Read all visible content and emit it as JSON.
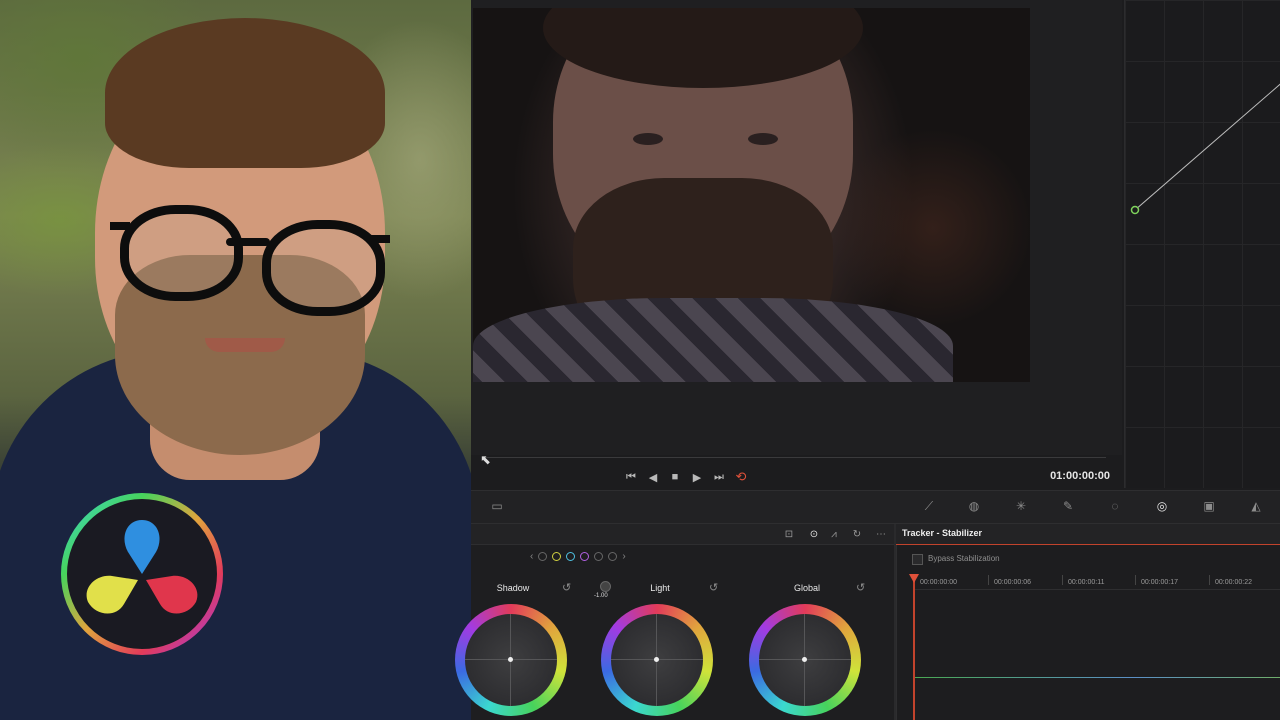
{
  "viewer": {
    "timecode": "01:00:00:00"
  },
  "transport": {
    "skip_back_glyph": "⏮",
    "prev_frame_glyph": "◀",
    "stop_glyph": "■",
    "play_glyph": "▶",
    "skip_forward_glyph": "⏭",
    "loop_glyph": "⟲"
  },
  "color_wheels": {
    "shadow_label": "Shadow",
    "light_label": "Light",
    "global_label": "Global",
    "light_value": "-1.00",
    "reset_glyph": "↺",
    "nav_prev": "‹",
    "nav_next": "›"
  },
  "tracker": {
    "title": "Tracker - Stabilizer",
    "bypass_label": "Bypass Stabilization",
    "ruler_times": [
      "00:00:00:00",
      "00:00:00:06",
      "00:00:00:11",
      "00:00:00:17",
      "00:00:00:22"
    ]
  },
  "colors": {
    "accent_red": "#e0513a",
    "panel_bg": "#1e1e20",
    "viewer_bg": "#1f1f21"
  },
  "icons": {
    "wheels_header": [
      "split-icon",
      "wheels-mode-icon",
      "bars-mode-icon",
      "reset-all-icon",
      "more-options-icon"
    ],
    "palette": [
      "viewer-mode-icon",
      "curves-icon",
      "qualifier-icon",
      "window-icon",
      "tracker-icon",
      "magic-mask-icon",
      "blur-icon",
      "key-icon",
      "sizing-icon",
      "3d-icon"
    ]
  }
}
